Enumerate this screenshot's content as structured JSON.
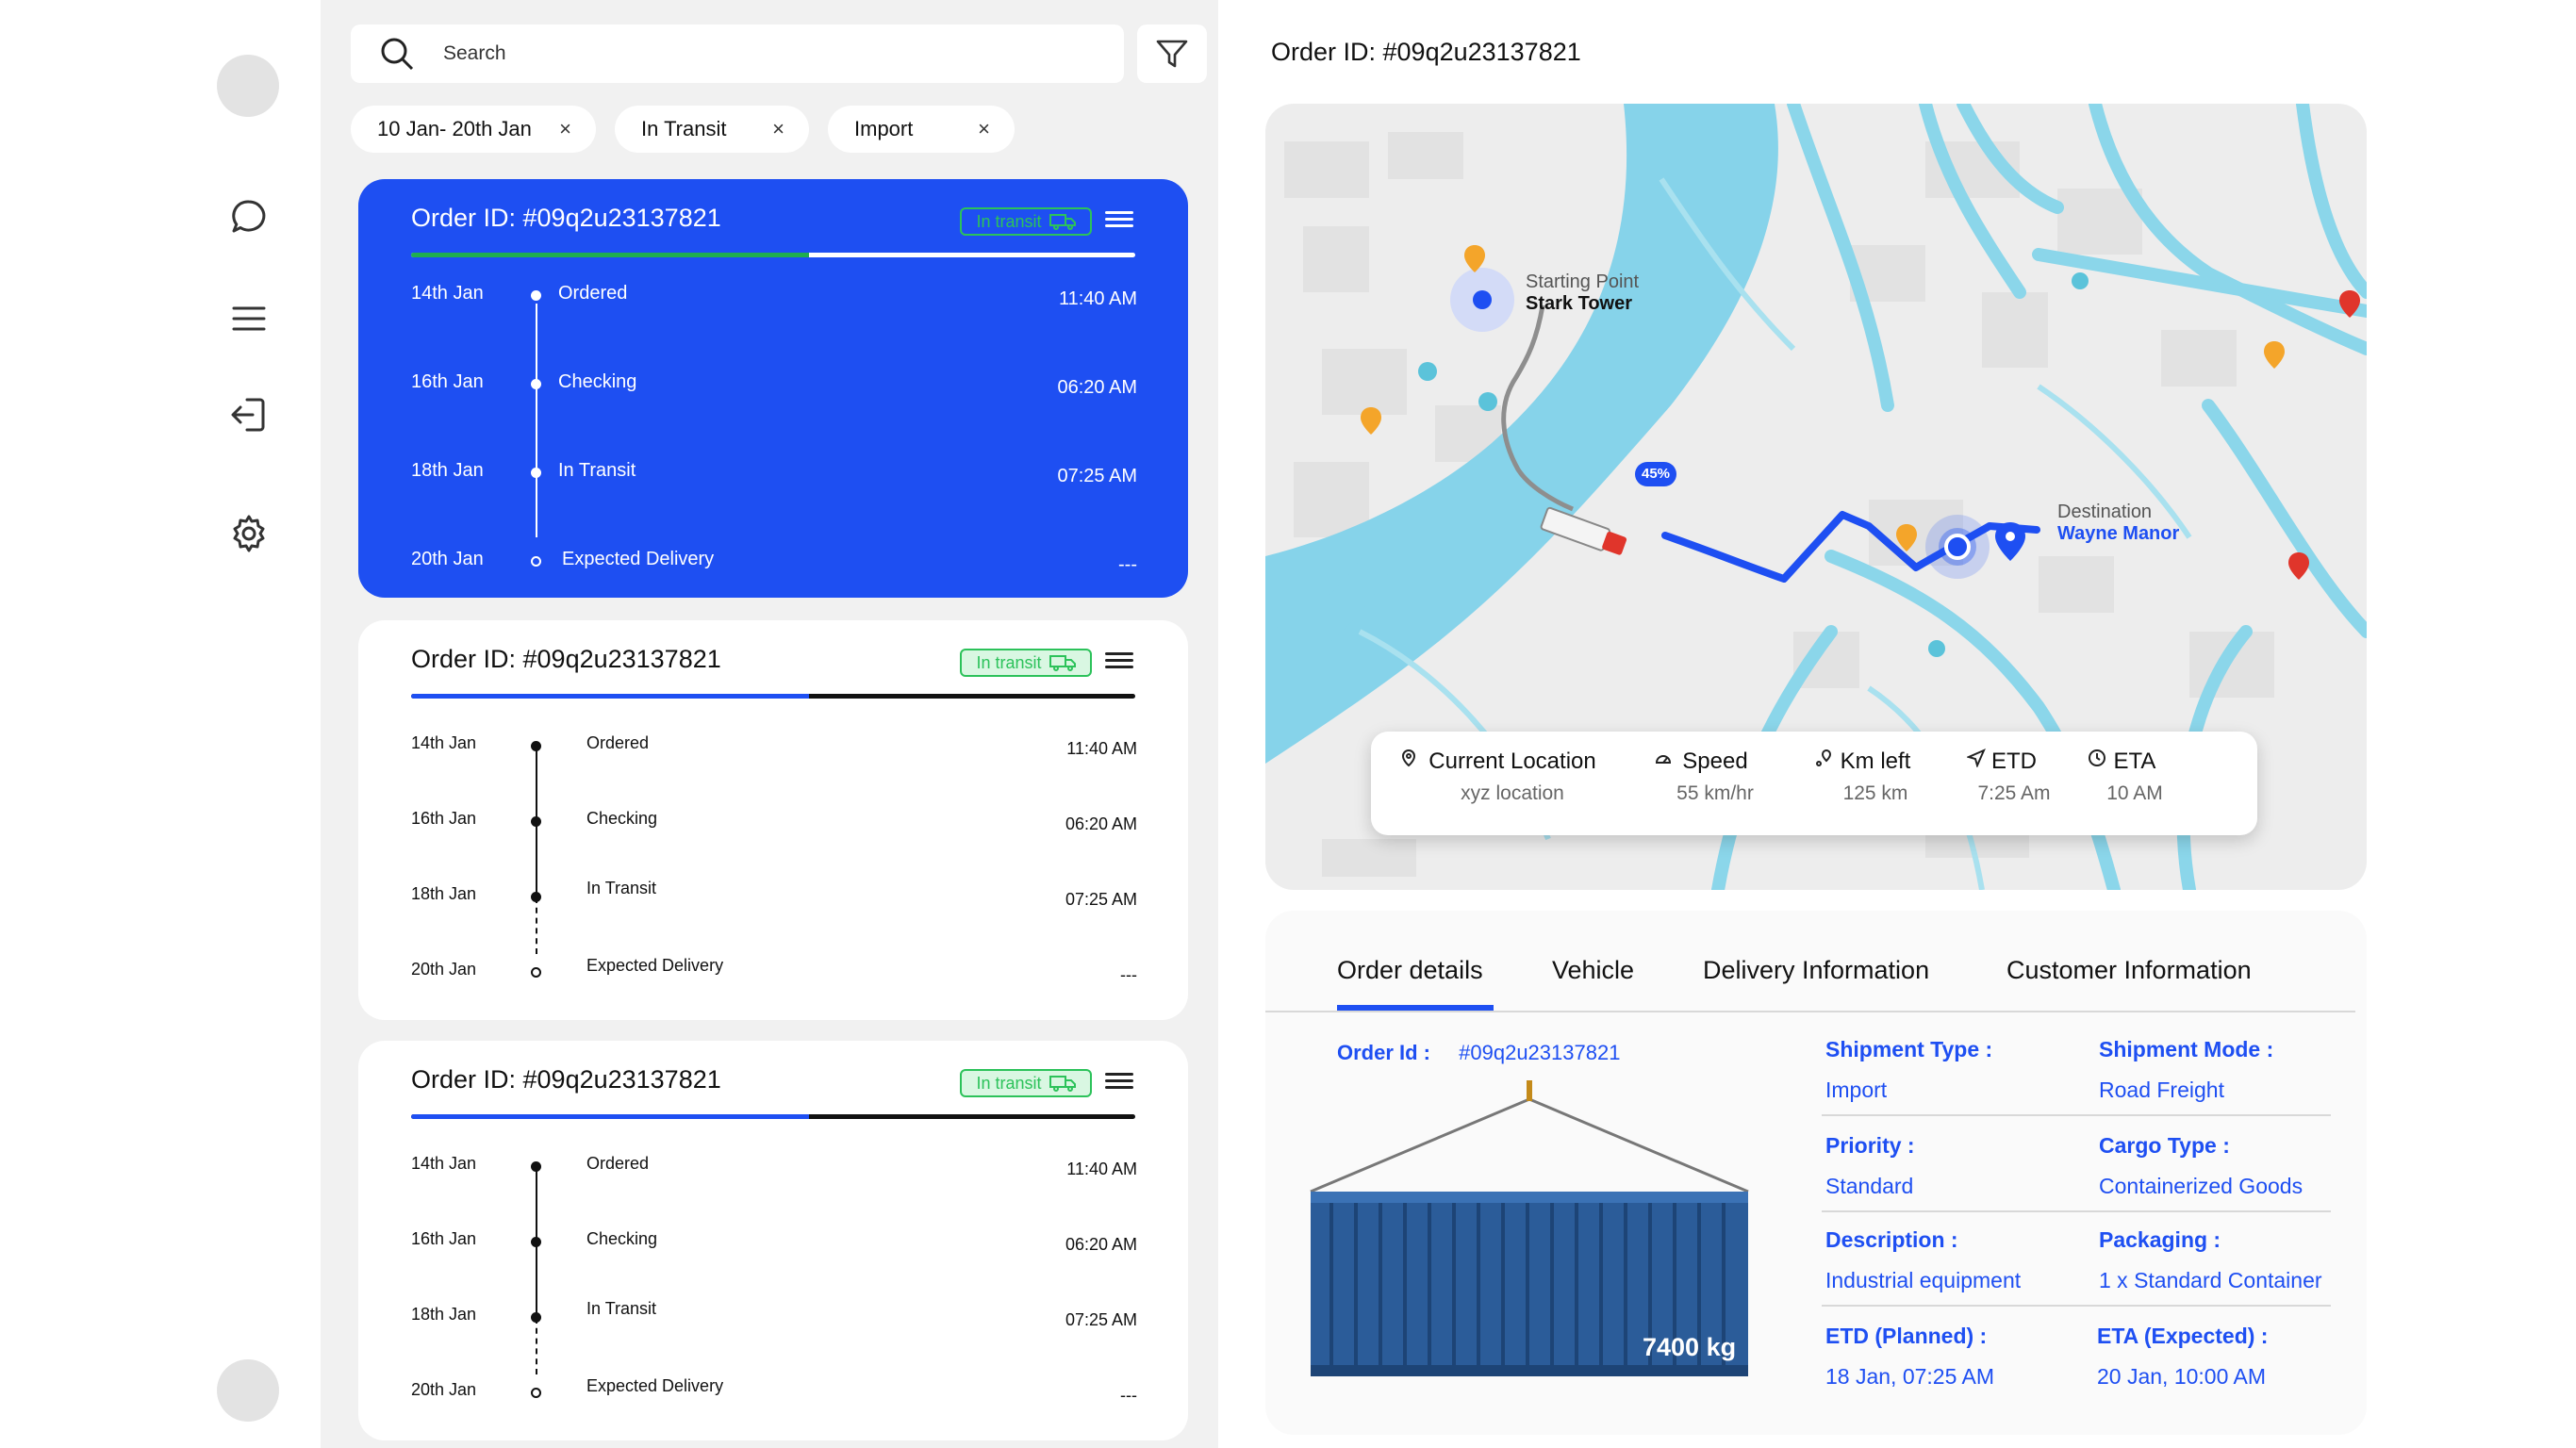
{
  "search": {
    "placeholder": "Search"
  },
  "filters": [
    {
      "label": "10 Jan- 20th Jan",
      "close": "×"
    },
    {
      "label": "In Transit",
      "close": "×"
    },
    {
      "label": "Import",
      "close": "×"
    }
  ],
  "orders": [
    {
      "title": "Order ID: #09q2u23137821",
      "badge": "In transit",
      "progress": 0.55,
      "steps": [
        {
          "date": "14th Jan",
          "label": "Ordered",
          "time": "11:40 AM"
        },
        {
          "date": "16th Jan",
          "label": "Checking",
          "time": "06:20 AM"
        },
        {
          "date": "18th Jan",
          "label": "In Transit",
          "time": "07:25 AM"
        },
        {
          "date": "20th Jan",
          "label": "Expected Delivery",
          "time": "---"
        }
      ]
    },
    {
      "title": "Order ID: #09q2u23137821",
      "badge": "In transit",
      "progress": 0.55,
      "steps": [
        {
          "date": "14th Jan",
          "label": "Ordered",
          "time": "11:40 AM"
        },
        {
          "date": "16th Jan",
          "label": "Checking",
          "time": "06:20 AM"
        },
        {
          "date": "18th Jan",
          "label": "In Transit",
          "time": "07:25 AM"
        },
        {
          "date": "20th Jan",
          "label": "Expected Delivery",
          "time": "---"
        }
      ]
    },
    {
      "title": "Order ID: #09q2u23137821",
      "badge": "In transit",
      "progress": 0.55,
      "steps": [
        {
          "date": "14th Jan",
          "label": "Ordered",
          "time": "11:40 AM"
        },
        {
          "date": "16th Jan",
          "label": "Checking",
          "time": "06:20 AM"
        },
        {
          "date": "18th Jan",
          "label": "In Transit",
          "time": "07:25 AM"
        },
        {
          "date": "20th Jan",
          "label": "Expected Delivery",
          "time": "---"
        }
      ]
    }
  ],
  "detail": {
    "title": "Order ID: #09q2u23137821",
    "map": {
      "start_caption": "Starting Point",
      "start_name": "Stark Tower",
      "dest_caption": "Destination",
      "dest_name": "Wayne Manor",
      "progress_badge": "45%"
    },
    "info": [
      {
        "label": "Current Location",
        "value": "xyz location",
        "icon": "location-pin-icon"
      },
      {
        "label": "Speed",
        "value": "55 km/hr",
        "icon": "speedometer-icon"
      },
      {
        "label": "Km left",
        "value": "125 km",
        "icon": "route-pin-icon"
      },
      {
        "label": "ETD",
        "value": "7:25 Am",
        "icon": "send-icon"
      },
      {
        "label": "ETA",
        "value": "10 AM",
        "icon": "clock-icon"
      }
    ],
    "tabs": [
      "Order details",
      "Vehicle",
      "Delivery Information",
      "Customer Information"
    ],
    "order_id_label": "Order Id :",
    "order_id_value": "#09q2u23137821",
    "weight": "7400 kg",
    "fields": [
      {
        "key": "Shipment Type :",
        "value": "Import"
      },
      {
        "key": "Shipment Mode :",
        "value": "Road Freight"
      },
      {
        "key": "Priority :",
        "value": "Standard"
      },
      {
        "key": "Cargo Type :",
        "value": "Containerized Goods"
      },
      {
        "key": "Description :",
        "value": "Industrial equipment"
      },
      {
        "key": "Packaging :",
        "value": "1 x Standard Container"
      },
      {
        "key": "ETD (Planned) :",
        "value": "18 Jan, 07:25 AM"
      },
      {
        "key": "ETA (Expected) :",
        "value": "20 Jan, 10:00 AM"
      }
    ]
  },
  "colors": {
    "accent": "#1e4ff2",
    "water": "#86d3ea",
    "roads": "#8bd6ea",
    "success": "#2cc25a"
  }
}
